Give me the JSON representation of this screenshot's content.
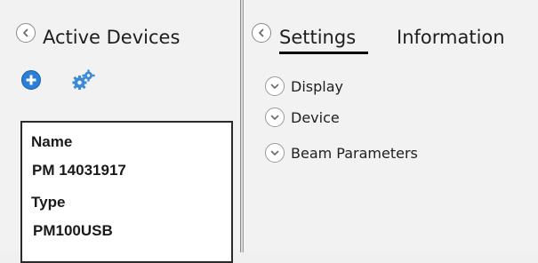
{
  "left_panel": {
    "title": "Active Devices",
    "icons": {
      "collapse": "chevron-left-circle-icon",
      "add": "add-device-plus-icon",
      "settings": "gears-icon"
    },
    "device": {
      "name_label": "Name",
      "name_value": "PM 14031917",
      "type_label": "Type",
      "type_value": "PM100USB"
    }
  },
  "right_panel": {
    "tabs": [
      {
        "label": "Settings",
        "active": true
      },
      {
        "label": "Information",
        "active": false
      }
    ],
    "sections": [
      {
        "label": "Display",
        "state": "collapsed"
      },
      {
        "label": "Device",
        "state": "collapsed"
      },
      {
        "label": "Beam Parameters",
        "state": "collapsed"
      }
    ]
  },
  "colors": {
    "accent_blue": "#2b7fd6",
    "gear_blue": "#3a8ad6",
    "background": "#f2f2f2"
  }
}
